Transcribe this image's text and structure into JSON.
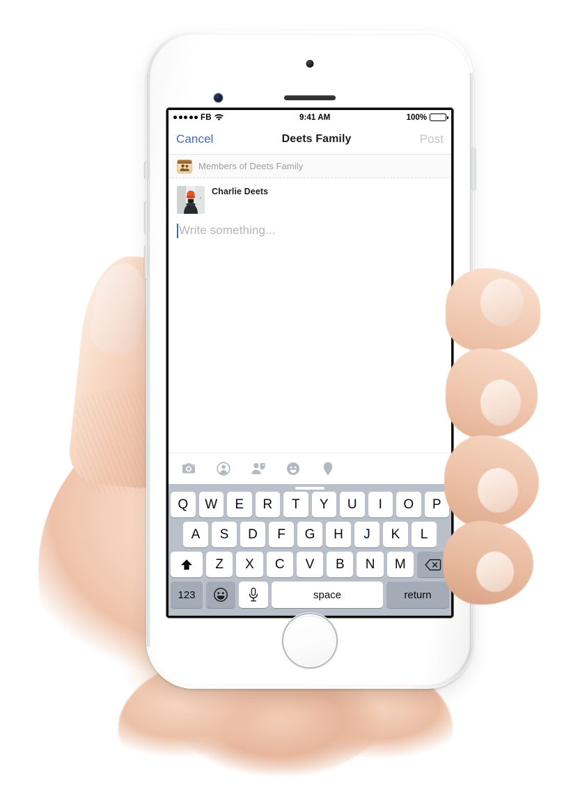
{
  "device": {
    "name": "iPhone",
    "color": "silver-white"
  },
  "status_bar": {
    "signal_dots": 5,
    "carrier": "FB",
    "wifi_icon": "wifi-icon",
    "time": "9:41 AM",
    "battery_percent": "100%",
    "battery_level": 100
  },
  "nav_bar": {
    "cancel_label": "Cancel",
    "title": "Deets Family",
    "post_label": "Post",
    "cancel_color": "#4267B2",
    "post_color": "#c3c6ca",
    "post_enabled": false
  },
  "privacy": {
    "icon": "group-members-icon",
    "label": "Members of Deets Family"
  },
  "composer": {
    "avatar_icon": "user-avatar-photo",
    "author_name": "Charlie Deets",
    "placeholder": "Write something...",
    "text_value": "",
    "caret_color": "#2d6cd6"
  },
  "attachments": [
    {
      "name": "camera-icon",
      "label": "Photo"
    },
    {
      "name": "live-video-icon",
      "label": "Live Video"
    },
    {
      "name": "tag-friends-icon",
      "label": "Tag Friends"
    },
    {
      "name": "feeling-icon",
      "label": "Feeling/Activity"
    },
    {
      "name": "location-pin-icon",
      "label": "Check In"
    }
  ],
  "keyboard": {
    "grabber": "keyboard-grabber-handle",
    "row1": [
      "Q",
      "W",
      "E",
      "R",
      "T",
      "Y",
      "U",
      "I",
      "O",
      "P"
    ],
    "row2": [
      "A",
      "S",
      "D",
      "F",
      "G",
      "H",
      "J",
      "K",
      "L"
    ],
    "row3": [
      "Z",
      "X",
      "C",
      "V",
      "B",
      "N",
      "M"
    ],
    "shift_icon": "shift-arrow-icon",
    "backspace_icon": "backspace-icon",
    "numbers_label": "123",
    "emoji_icon": "emoji-smiley-icon",
    "dictation_icon": "microphone-icon",
    "space_label": "space",
    "return_label": "return",
    "background_color": "#b9c0c9",
    "key_color": "#ffffff",
    "modifier_key_color": "#a3abb6"
  }
}
